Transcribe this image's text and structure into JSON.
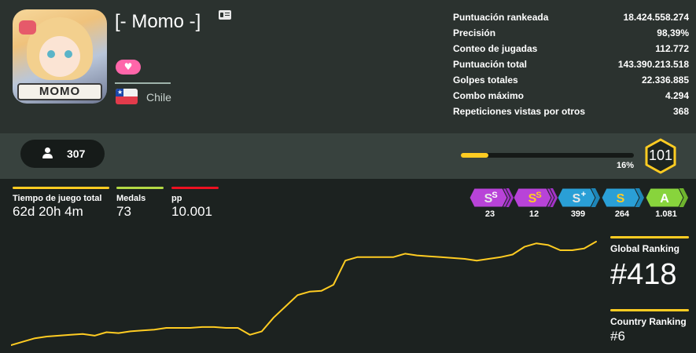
{
  "profile": {
    "username": "[- Momo -]",
    "avatar_text": "MOMO",
    "country": "Chile",
    "supporter_icon": "heart-icon"
  },
  "stats": [
    {
      "label": "Puntuación rankeada",
      "value": "18.424.558.274"
    },
    {
      "label": "Precisión",
      "value": "98,39%"
    },
    {
      "label": "Conteo de jugadas",
      "value": "112.772"
    },
    {
      "label": "Puntuación total",
      "value": "143.390.213.518"
    },
    {
      "label": "Golpes totales",
      "value": "22.336.885"
    },
    {
      "label": "Combo máximo",
      "value": "4.294"
    },
    {
      "label": "Repeticiones vistas por otros",
      "value": "368"
    }
  ],
  "social": {
    "followers": "307"
  },
  "level": {
    "current": "101",
    "progress": 0.16,
    "progress_label": "16%"
  },
  "mini_stats": [
    {
      "label": "Tiempo de juego total",
      "value": "62d 20h 4m",
      "color": "#ffcc22"
    },
    {
      "label": "Medals",
      "value": "73",
      "color": "#b3d944"
    },
    {
      "label": "pp",
      "value": "10.001",
      "color": "#ed1121"
    }
  ],
  "grades": [
    {
      "name": "SS+",
      "count": "23"
    },
    {
      "name": "SS",
      "count": "12"
    },
    {
      "name": "S+",
      "count": "399"
    },
    {
      "name": "S",
      "count": "264"
    },
    {
      "name": "A",
      "count": "1.081"
    }
  ],
  "ranking": {
    "global_label": "Global Ranking",
    "global_value": "#418",
    "country_label": "Country Ranking",
    "country_value": "#6"
  },
  "rank_history": [
    10,
    14,
    18,
    20,
    21,
    22,
    23,
    21,
    25,
    24,
    26,
    27,
    28,
    30,
    30,
    30,
    31,
    31,
    30,
    30,
    22,
    26,
    42,
    55,
    68,
    72,
    73,
    80,
    108,
    112,
    112,
    112,
    112,
    116,
    114,
    113,
    112,
    111,
    110,
    108,
    110,
    112,
    115,
    124,
    128,
    126,
    120,
    120,
    122,
    130
  ],
  "colors": {
    "accent": "#ffcc22",
    "header_bg": "#2b322f",
    "page_bg": "#1c2220",
    "supporter": "#ff66aa"
  }
}
